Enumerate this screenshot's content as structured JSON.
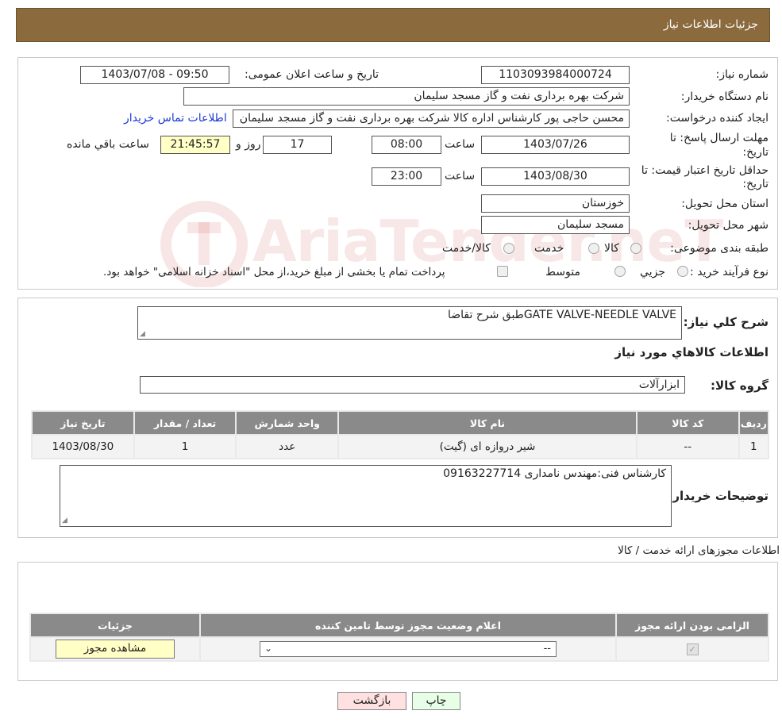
{
  "header": {
    "title": "جزئیات اطلاعات نیاز"
  },
  "form": {
    "need_number_label": "شماره نیاز:",
    "need_number": "1103093984000724",
    "announce_label": "تاریخ و ساعت اعلان عمومی:",
    "announce_value": "1403/07/08 - 09:50",
    "buyer_org_label": "نام دستگاه خریدار:",
    "buyer_org": "شرکت بهره برداری نفت و گاز مسجد سلیمان",
    "requester_label": "ایجاد کننده درخواست:",
    "requester": "محسن حاجی پور کارشناس اداره کالا  شرکت بهره برداری نفت و گاز مسجد سلیمان",
    "contact_link": "اطلاعات تماس خریدار",
    "deadline_label_1": "مهلت ارسال پاسخ: تا",
    "deadline_label_2": "تاریخ:",
    "deadline_date": "1403/07/26",
    "time_label": "ساعت",
    "deadline_time": "08:00",
    "days_value": "17",
    "days_label": "روز و",
    "remaining_time": "21:45:57",
    "remaining_label": "ساعت باقي مانده",
    "validity_label_1": "حداقل تاریخ اعتبار قیمت: تا",
    "validity_label_2": "تاریخ:",
    "validity_date": "1403/08/30",
    "validity_time": "23:00",
    "province_label": "استان محل تحویل:",
    "province": "خوزستان",
    "city_label": "شهر محل تحویل:",
    "city": "مسجد سلیمان",
    "category_label": "طبقه بندی موضوعی:",
    "category_options": [
      "کالا",
      "خدمت",
      "کالا/خدمت"
    ],
    "purchase_type_label": "نوع فرآیند خرید :",
    "purchase_options": [
      "جزيي",
      "متوسط"
    ],
    "purchase_note": "پرداخت تمام یا بخشی از مبلغ خرید،از محل \"اسناد خزانه اسلامی\" خواهد بود."
  },
  "details": {
    "general_desc_label": "شرح کلي نياز:",
    "general_desc": "GATE VALVE-NEEDLE VALVEطبق شرح تقاضا",
    "goods_info_title": "اطلاعات کالاهاي مورد نياز",
    "goods_group_label": "گروه کالا:",
    "goods_group": "ابزارآلات",
    "table_headers": [
      "ردیف",
      "کد کالا",
      "نام کالا",
      "واحد شمارش",
      "تعداد / مقدار",
      "تاریخ نیاز"
    ],
    "table_rows": [
      [
        "1",
        "--",
        "شیر دروازه ای (گیت)",
        "عدد",
        "1",
        "1403/08/30"
      ]
    ],
    "buyer_notes_label": "توضیحات خریدار:",
    "buyer_notes": "کارشناس فنی:مهندس نامداری 09163227714"
  },
  "licenses": {
    "title": "اطلاعات مجوزهای ارائه خدمت / کالا",
    "headers": [
      "الزامی بودن ارائه مجوز",
      "اعلام وضعیت مجوز توسط تامین کننده",
      "جزئیات"
    ],
    "select_value": "--",
    "view_button": "مشاهده مجوز"
  },
  "buttons": {
    "print": "چاپ",
    "back": "بازگشت"
  },
  "watermark": {
    "text": "AriaTender.neT"
  },
  "colors": {
    "header_bg": "#8b6a3e",
    "link": "#1a3ad6",
    "remaining_bg": "#ffffc6",
    "back_bg": "#ffe1e1",
    "print_bg": "#e6ffe6"
  }
}
